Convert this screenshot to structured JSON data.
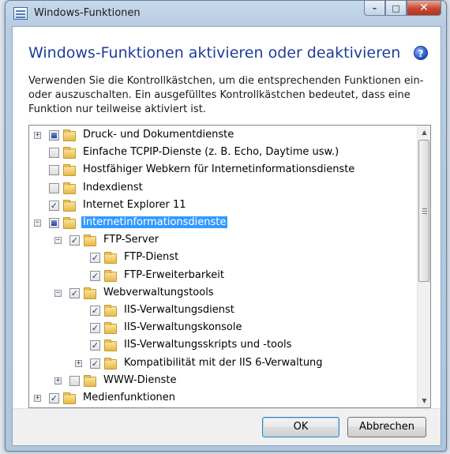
{
  "window": {
    "title": "Windows-Funktionen",
    "controls": {
      "minimize": "–",
      "maximize": "□",
      "close": "✕"
    }
  },
  "header": {
    "heading": "Windows-Funktionen aktivieren oder deaktivieren",
    "help_icon": "question-circle-icon",
    "description": "Verwenden Sie die Kontrollkästchen, um die entsprechenden Funktionen ein- oder auszuschalten. Ein ausgefülltes Kontrollkästchen bedeutet, dass eine Funktion nur teilweise aktiviert ist."
  },
  "tree": {
    "items": [
      {
        "label": "Druck- und Dokumentdienste",
        "level": 0,
        "state": "partial",
        "expander": "+"
      },
      {
        "label": "Einfache TCPIP-Dienste (z. B. Echo, Daytime usw.)",
        "level": 0,
        "state": "unchecked",
        "expander": ""
      },
      {
        "label": "Hostfähiger Webkern für Internetinformationsdienste",
        "level": 0,
        "state": "unchecked",
        "expander": ""
      },
      {
        "label": "Indexdienst",
        "level": 0,
        "state": "unchecked",
        "expander": ""
      },
      {
        "label": "Internet Explorer 11",
        "level": 0,
        "state": "checked",
        "expander": ""
      },
      {
        "label": "Internetinformationsdienste",
        "level": 0,
        "state": "partial",
        "expander": "−",
        "selected": true
      },
      {
        "label": "FTP-Server",
        "level": 1,
        "state": "checked",
        "expander": "−"
      },
      {
        "label": "FTP-Dienst",
        "level": 2,
        "state": "checked",
        "expander": ""
      },
      {
        "label": "FTP-Erweiterbarkeit",
        "level": 2,
        "state": "checked",
        "expander": ""
      },
      {
        "label": "Webverwaltungstools",
        "level": 1,
        "state": "checked",
        "expander": "−"
      },
      {
        "label": "IIS-Verwaltungsdienst",
        "level": 2,
        "state": "checked",
        "expander": ""
      },
      {
        "label": "IIS-Verwaltungskonsole",
        "level": 2,
        "state": "checked",
        "expander": ""
      },
      {
        "label": "IIS-Verwaltungsskripts und -tools",
        "level": 2,
        "state": "checked",
        "expander": ""
      },
      {
        "label": "Kompatibilität mit der IIS 6-Verwaltung",
        "level": 2,
        "state": "checked",
        "expander": "+"
      },
      {
        "label": "WWW-Dienste",
        "level": 1,
        "state": "unchecked",
        "expander": "+"
      },
      {
        "label": "Medienfunktionen",
        "level": 0,
        "state": "checked",
        "expander": "+"
      }
    ],
    "scroll_up": "▲",
    "scroll_down": "▼"
  },
  "footer": {
    "ok_label": "OK",
    "cancel_label": "Abbrechen"
  },
  "colors": {
    "heading": "#1e3d9a",
    "selection": "#3399ff",
    "close_button": "#c7452e"
  }
}
